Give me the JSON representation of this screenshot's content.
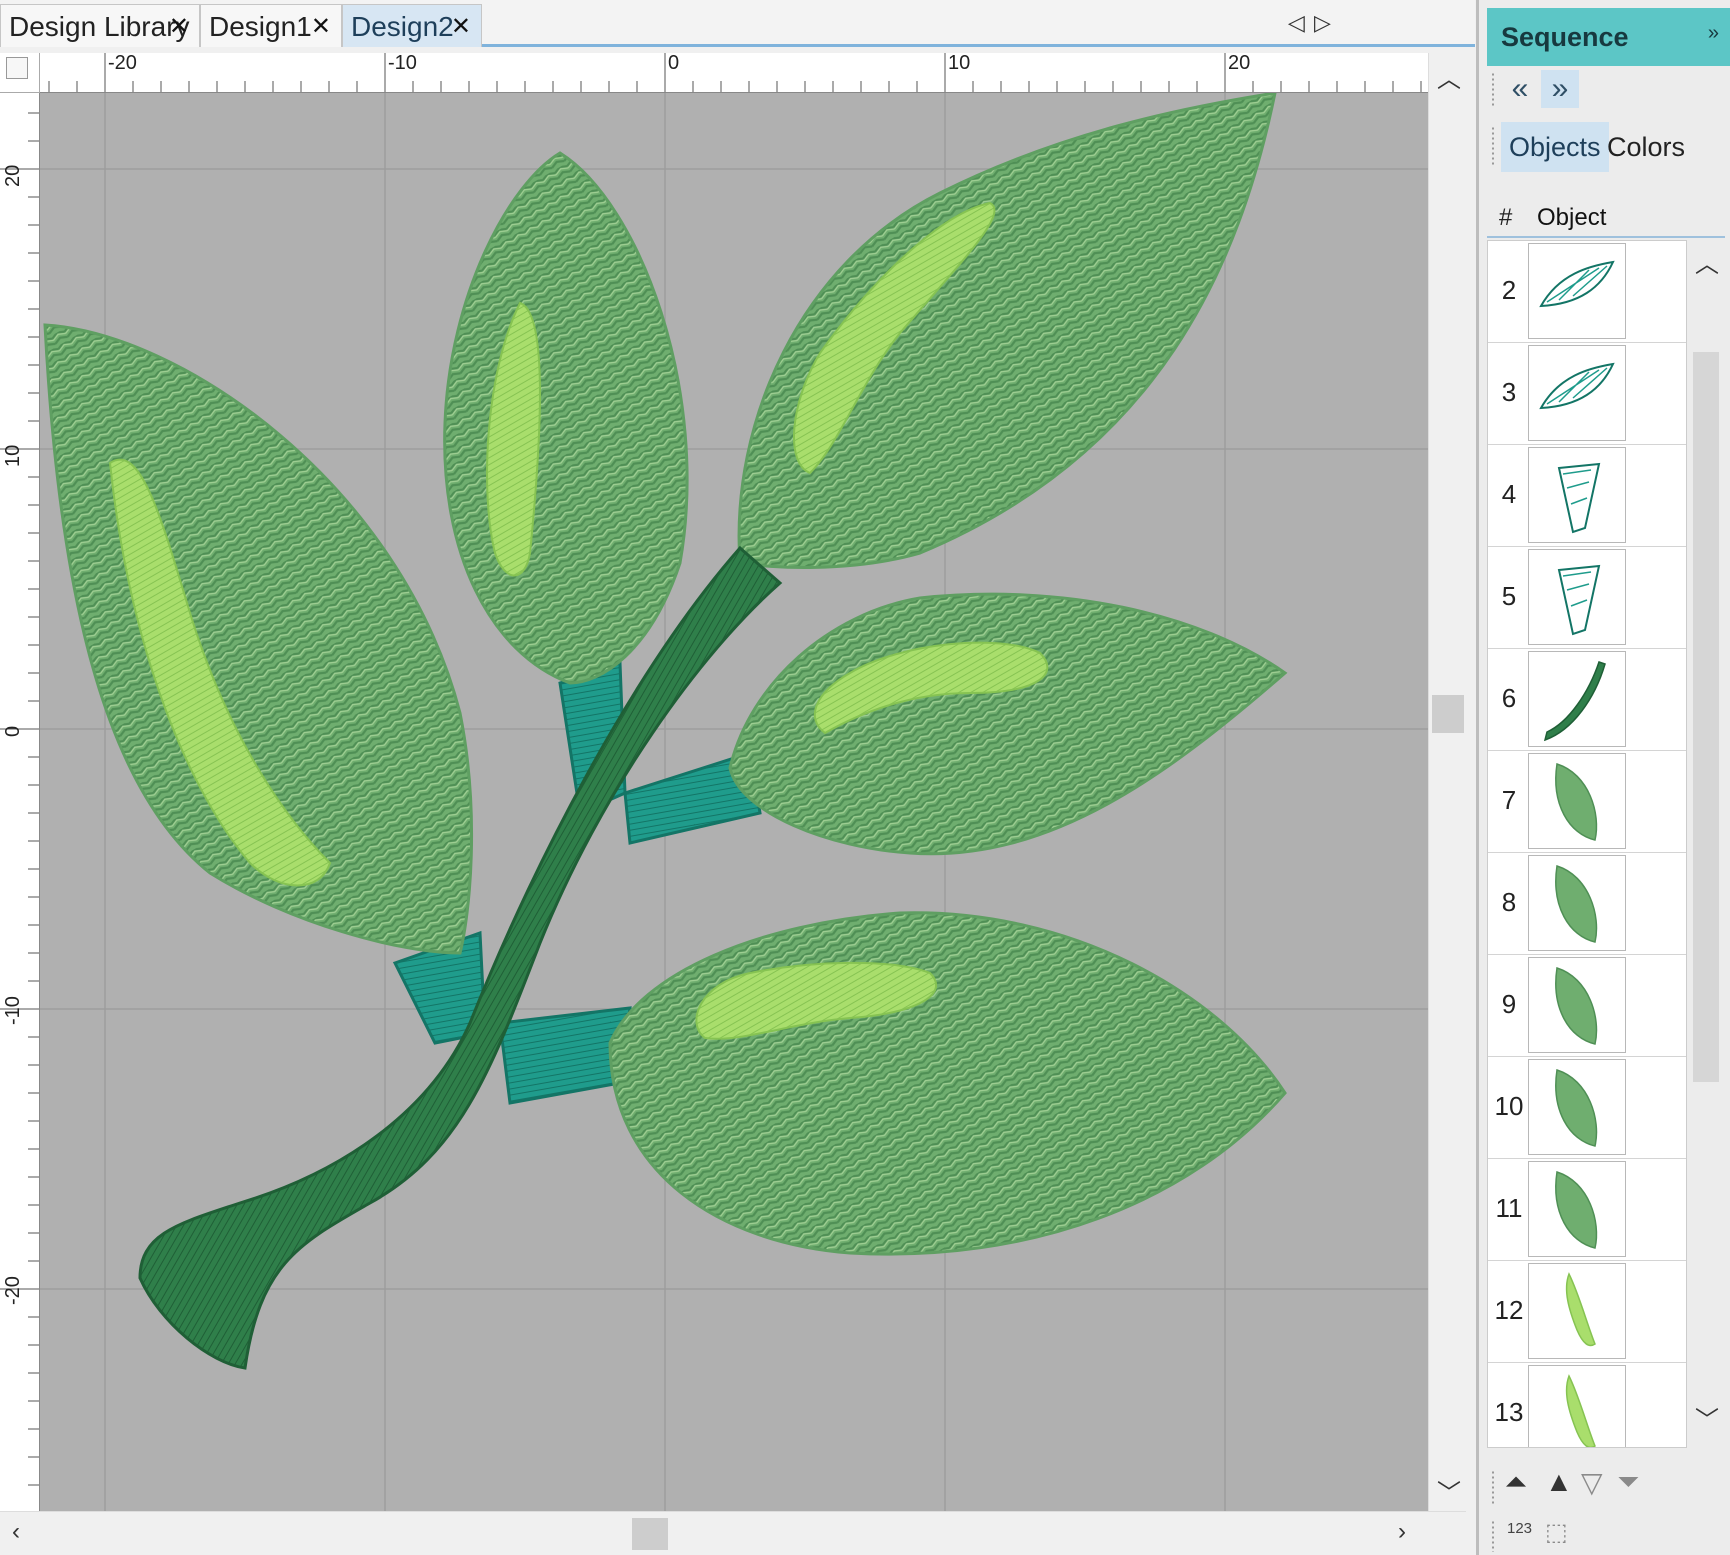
{
  "tabs": [
    {
      "label": "Design Library",
      "active": false
    },
    {
      "label": "Design1",
      "active": false
    },
    {
      "label": "Design2",
      "active": true
    }
  ],
  "tab_close_glyph": "✕",
  "tab_nav": {
    "prev_icon": "triangle-left-icon",
    "next_icon": "triangle-right-icon"
  },
  "ruler": {
    "horizontal_labels": [
      "-20",
      "-10",
      "0",
      "10",
      "20"
    ],
    "vertical_labels": [
      "20",
      "10",
      "0",
      "-10",
      "-20"
    ],
    "unit_spacing_hint": "10 units per major tick"
  },
  "canvas": {
    "background_color": "#b0b0b0",
    "grid_color": "#9a9a9a",
    "design": {
      "leaf_color": "#6fae6f",
      "leaf_highlight_color": "#9fd86a",
      "stem_color": "#2f7f4a",
      "connector_color": "#1f9c8c"
    }
  },
  "sequence_panel": {
    "title": "Sequence",
    "collapse_icon": "double-chevron-right-icon",
    "nav": {
      "prev_icon": "double-chevron-left-icon",
      "next_icon": "double-chevron-right-icon"
    },
    "tabs": [
      {
        "label": "Objects",
        "active": true
      },
      {
        "label": "Colors",
        "active": false
      }
    ],
    "columns": {
      "number": "#",
      "object": "Object"
    },
    "objects": [
      {
        "number": "2",
        "icon": "leaf-outline-teal-icon"
      },
      {
        "number": "3",
        "icon": "leaf-outline-teal-icon"
      },
      {
        "number": "4",
        "icon": "connector-teal-icon"
      },
      {
        "number": "5",
        "icon": "connector-teal-icon"
      },
      {
        "number": "6",
        "icon": "stem-dark-green-icon"
      },
      {
        "number": "7",
        "icon": "leaf-green-icon"
      },
      {
        "number": "8",
        "icon": "leaf-green-icon"
      },
      {
        "number": "9",
        "icon": "leaf-green-icon"
      },
      {
        "number": "10",
        "icon": "leaf-green-icon"
      },
      {
        "number": "11",
        "icon": "leaf-green-icon"
      },
      {
        "number": "12",
        "icon": "vein-light-green-icon"
      },
      {
        "number": "13",
        "icon": "vein-light-green-icon"
      }
    ],
    "bottom_tools": [
      {
        "name": "move-to-start",
        "icon": "move-to-start-icon"
      },
      {
        "name": "move-up",
        "icon": "move-up-icon"
      },
      {
        "name": "move-down",
        "icon": "move-down-icon"
      },
      {
        "name": "move-to-end",
        "icon": "move-to-end-icon"
      }
    ],
    "bottom_tools_2": [
      {
        "name": "sort-by-number",
        "icon": "sort-123-icon",
        "text": "123"
      },
      {
        "name": "select-object",
        "icon": "select-object-icon"
      }
    ]
  }
}
